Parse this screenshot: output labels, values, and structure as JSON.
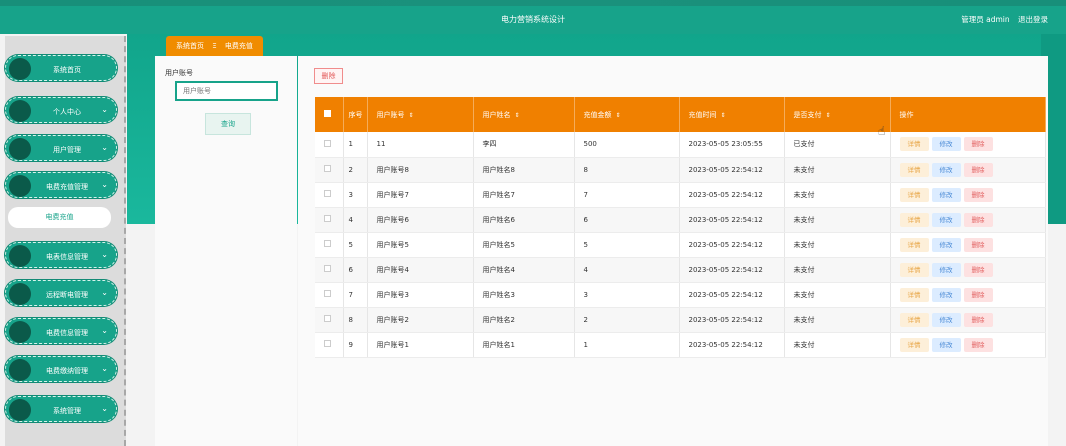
{
  "header": {
    "title": "电力营销系统设计",
    "user_label": "管理员 admin",
    "logout": "退出登录"
  },
  "sidebar": {
    "items": [
      {
        "label": "系统首页",
        "has_chevron": false
      },
      {
        "label": "个人中心",
        "has_chevron": true
      },
      {
        "label": "用户管理",
        "has_chevron": true
      },
      {
        "label": "电费充值管理",
        "has_chevron": true
      },
      {
        "label": "电表信息管理",
        "has_chevron": true
      },
      {
        "label": "远程断电管理",
        "has_chevron": true
      },
      {
        "label": "电费信息管理",
        "has_chevron": true
      },
      {
        "label": "电费缴纳管理",
        "has_chevron": true
      },
      {
        "label": "系统管理",
        "has_chevron": true
      }
    ],
    "sub_item": "电费充值"
  },
  "breadcrumb": {
    "home": "系统首页",
    "sep": "Ξ",
    "current": "电费充值"
  },
  "search": {
    "label": "用户账号",
    "placeholder": "用户账号",
    "button": "查询"
  },
  "toolbar": {
    "delete": "删除"
  },
  "table": {
    "columns": [
      "序号",
      "用户账号",
      "用户姓名",
      "充值金额",
      "充值时间",
      "是否支付",
      "操作"
    ],
    "rows": [
      {
        "no": "1",
        "account": "11",
        "name": "李四",
        "amount": "500",
        "time": "2023-05-05 23:05:55",
        "paid": "已支付"
      },
      {
        "no": "2",
        "account": "用户账号8",
        "name": "用户姓名8",
        "amount": "8",
        "time": "2023-05-05 22:54:12",
        "paid": "未支付"
      },
      {
        "no": "3",
        "account": "用户账号7",
        "name": "用户姓名7",
        "amount": "7",
        "time": "2023-05-05 22:54:12",
        "paid": "未支付"
      },
      {
        "no": "4",
        "account": "用户账号6",
        "name": "用户姓名6",
        "amount": "6",
        "time": "2023-05-05 22:54:12",
        "paid": "未支付"
      },
      {
        "no": "5",
        "account": "用户账号5",
        "name": "用户姓名5",
        "amount": "5",
        "time": "2023-05-05 22:54:12",
        "paid": "未支付"
      },
      {
        "no": "6",
        "account": "用户账号4",
        "name": "用户姓名4",
        "amount": "4",
        "time": "2023-05-05 22:54:12",
        "paid": "未支付"
      },
      {
        "no": "7",
        "account": "用户账号3",
        "name": "用户姓名3",
        "amount": "3",
        "time": "2023-05-05 22:54:12",
        "paid": "未支付"
      },
      {
        "no": "8",
        "account": "用户账号2",
        "name": "用户姓名2",
        "amount": "2",
        "time": "2023-05-05 22:54:12",
        "paid": "未支付"
      },
      {
        "no": "9",
        "account": "用户账号1",
        "name": "用户姓名1",
        "amount": "1",
        "time": "2023-05-05 22:54:12",
        "paid": "未支付"
      }
    ],
    "actions": {
      "detail": "详情",
      "edit": "修改",
      "delete": "删除"
    }
  },
  "colors": {
    "primary": "#17a38a",
    "accent": "#f08000"
  }
}
